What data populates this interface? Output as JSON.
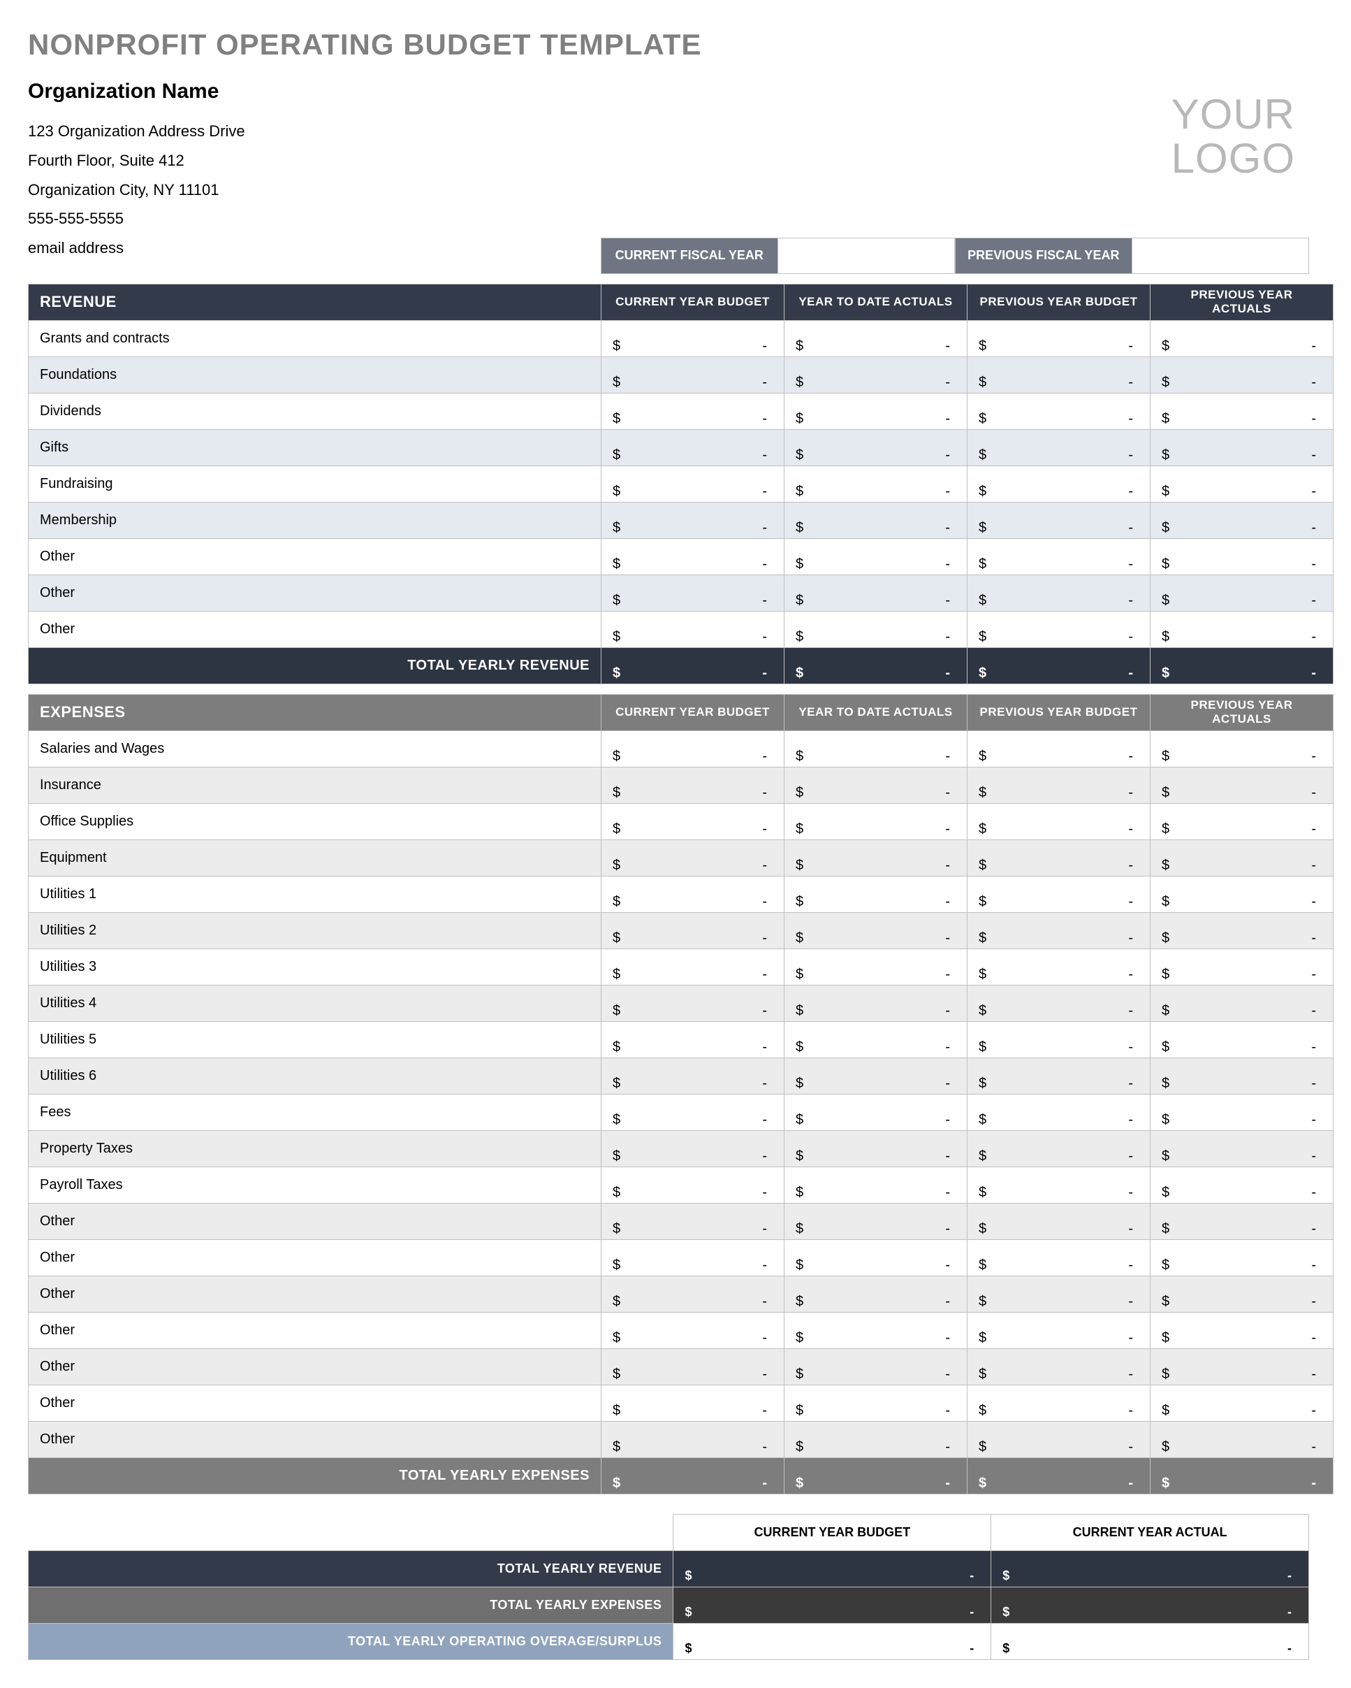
{
  "title": "NONPROFIT OPERATING BUDGET TEMPLATE",
  "org": {
    "name": "Organization Name",
    "addr1": "123 Organization Address Drive",
    "addr2": "Fourth Floor, Suite 412",
    "addr3": "Organization City, NY  11101",
    "phone": "555-555-5555",
    "email": "email address"
  },
  "logo_line1": "YOUR",
  "logo_line2": "LOGO",
  "fiscal": {
    "current_label": "CURRENT FISCAL YEAR",
    "current_value": "",
    "previous_label": "PREVIOUS FISCAL YEAR",
    "previous_value": ""
  },
  "columns": {
    "c1": "CURRENT YEAR BUDGET",
    "c2": "YEAR TO DATE ACTUALS",
    "c3": "PREVIOUS YEAR BUDGET",
    "c4": "PREVIOUS YEAR ACTUALS"
  },
  "currency_symbol": "$",
  "placeholder": "-",
  "revenue": {
    "title": "REVENUE",
    "items": [
      {
        "label": "Grants and contracts"
      },
      {
        "label": "Foundations"
      },
      {
        "label": "Dividends"
      },
      {
        "label": "Gifts"
      },
      {
        "label": "Fundraising"
      },
      {
        "label": "Membership"
      },
      {
        "label": "Other"
      },
      {
        "label": "Other"
      },
      {
        "label": "Other"
      }
    ],
    "total_label": "TOTAL YEARLY REVENUE"
  },
  "expenses": {
    "title": "EXPENSES",
    "items": [
      {
        "label": "Salaries and Wages"
      },
      {
        "label": "Insurance"
      },
      {
        "label": "Office Supplies"
      },
      {
        "label": "Equipment"
      },
      {
        "label": "Utilities 1"
      },
      {
        "label": "Utilities 2"
      },
      {
        "label": "Utilities 3"
      },
      {
        "label": "Utilities 4"
      },
      {
        "label": "Utilities 5"
      },
      {
        "label": "Utilities 6"
      },
      {
        "label": "Fees"
      },
      {
        "label": "Property Taxes"
      },
      {
        "label": "Payroll Taxes"
      },
      {
        "label": "Other"
      },
      {
        "label": "Other"
      },
      {
        "label": "Other"
      },
      {
        "label": "Other"
      },
      {
        "label": "Other"
      },
      {
        "label": "Other"
      },
      {
        "label": "Other"
      }
    ],
    "total_label": "TOTAL YEARLY EXPENSES"
  },
  "summary": {
    "col1": "CURRENT YEAR BUDGET",
    "col2": "CURRENT YEAR ACTUAL",
    "rev_label": "TOTAL YEARLY REVENUE",
    "exp_label": "TOTAL YEARLY EXPENSES",
    "surp_label": "TOTAL YEARLY OPERATING OVERAGE/SURPLUS"
  }
}
